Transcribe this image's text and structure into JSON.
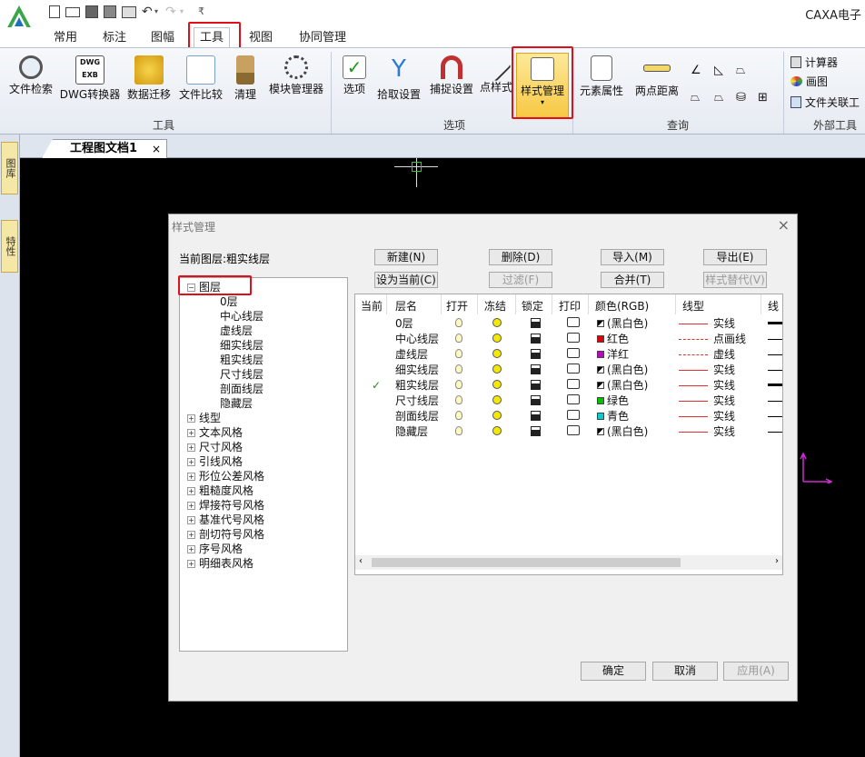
{
  "title_bar": {
    "app_title": "CAXA电子",
    "qa_glyph": "₹"
  },
  "tabs": [
    "常用",
    "标注",
    "图幅",
    "工具",
    "视图",
    "协同管理"
  ],
  "ribbon": {
    "tools": [
      "文件检索",
      "DWG转换器",
      "数据迁移",
      "文件比较",
      "清理",
      "模块管理器"
    ],
    "tools_group": "工具",
    "options": [
      "选项",
      "拾取设置",
      "捕捉设置",
      "点样式",
      "样式管理"
    ],
    "options_group": "选项",
    "query": [
      "元素属性",
      "两点距离"
    ],
    "query_group": "查询",
    "external": [
      "计算器",
      "画图",
      "文件关联工"
    ],
    "external_group": "外部工具"
  },
  "left_tabs": [
    "图库",
    "特性"
  ],
  "doc_tab": "工程图文档1",
  "dialog": {
    "title": "样式管理",
    "current_layer": "当前图层:粗实线层",
    "buttons_row1": [
      "新建(N)",
      "删除(D)",
      "导入(M)",
      "导出(E)"
    ],
    "buttons_row2": [
      "设为当前(C)",
      "过滤(F)",
      "合并(T)",
      "样式替代(V)"
    ],
    "tree_root": "图层",
    "tree_layers": [
      "0层",
      "中心线层",
      "虚线层",
      "细实线层",
      "粗实线层",
      "尺寸线层",
      "剖面线层",
      "隐藏层"
    ],
    "tree_groups": [
      "线型",
      "文本风格",
      "尺寸风格",
      "引线风格",
      "形位公差风格",
      "粗糙度风格",
      "焊接符号风格",
      "基准代号风格",
      "剖切符号风格",
      "序号风格",
      "明细表风格"
    ],
    "columns": [
      "当前",
      "层名",
      "打开",
      "冻结",
      "锁定",
      "打印",
      "颜色(RGB)",
      "线型",
      "线"
    ],
    "rows": [
      {
        "current": "",
        "name": "0层",
        "color": "(黑白色)",
        "swatch": "#000000",
        "ltype": "实线",
        "lstyle": "solid",
        "w": "bold"
      },
      {
        "current": "",
        "name": "中心线层",
        "color": "红色",
        "swatch": "#e00000",
        "ltype": "点画线",
        "lstyle": "dashdot",
        "w": "thin"
      },
      {
        "current": "",
        "name": "虚线层",
        "color": "洋红",
        "swatch": "#c000c0",
        "ltype": "虚线",
        "lstyle": "dash",
        "w": "thin"
      },
      {
        "current": "",
        "name": "细实线层",
        "color": "(黑白色)",
        "swatch": "#000000",
        "ltype": "实线",
        "lstyle": "solid",
        "w": "thin"
      },
      {
        "current": "✓",
        "name": "粗实线层",
        "color": "(黑白色)",
        "swatch": "#000000",
        "ltype": "实线",
        "lstyle": "solid",
        "w": "bold"
      },
      {
        "current": "",
        "name": "尺寸线层",
        "color": "绿色",
        "swatch": "#00c000",
        "ltype": "实线",
        "lstyle": "solid",
        "w": "thin"
      },
      {
        "current": "",
        "name": "剖面线层",
        "color": "青色",
        "swatch": "#00d0d0",
        "ltype": "实线",
        "lstyle": "solid",
        "w": "thin"
      },
      {
        "current": "",
        "name": "隐藏层",
        "color": "(黑白色)",
        "swatch": "#000000",
        "ltype": "实线",
        "lstyle": "solid",
        "w": "thin"
      }
    ],
    "ok": "确定",
    "cancel": "取消",
    "apply": "应用(A)"
  }
}
